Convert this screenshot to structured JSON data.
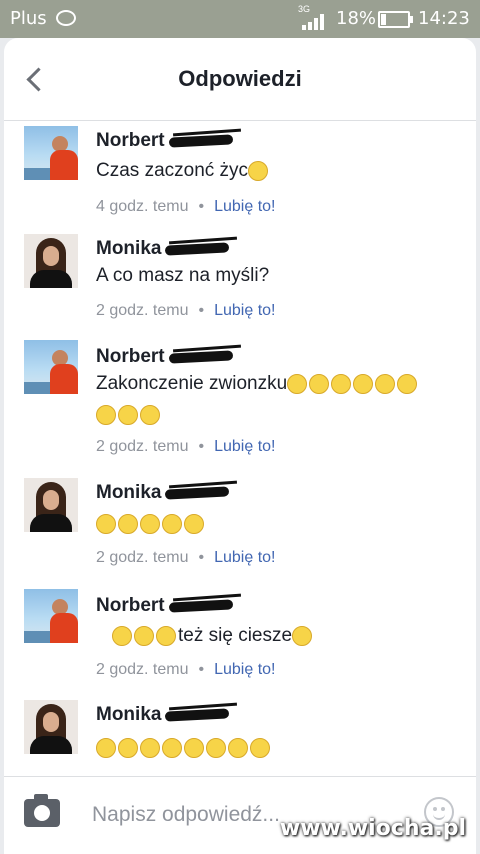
{
  "status_bar": {
    "carrier": "Plus",
    "network": "3G",
    "battery": "18%",
    "battery_level": 0.18,
    "time": "14:23"
  },
  "header": {
    "title": "Odpowiedzi",
    "back_icon": "chevron-left-icon"
  },
  "comments": [
    {
      "author": "Norbert",
      "avatar": "norbert",
      "text": "Czas zaczonć życ",
      "emoji_count": 1,
      "time": "4 godz. temu",
      "like": "Lubię to!"
    },
    {
      "author": "Monika",
      "avatar": "monika",
      "text": "A co masz na myśli?",
      "emoji_count": 0,
      "time": "2 godz. temu",
      "like": "Lubię to!"
    },
    {
      "author": "Norbert",
      "avatar": "norbert",
      "text": "Zakonczenie zwionzku",
      "emoji_count": 9,
      "time": "2 godz. temu",
      "like": "Lubię to!"
    },
    {
      "author": "Monika",
      "avatar": "monika",
      "text": "",
      "emoji_count": 5,
      "time": "2 godz. temu",
      "like": "Lubię to!"
    },
    {
      "author": "Norbert",
      "avatar": "norbert",
      "text": "też się ciesze",
      "emoji_count": 4,
      "time": "2 godz. temu",
      "like": "Lubię to!"
    },
    {
      "author": "Monika",
      "avatar": "monika",
      "text": "",
      "emoji_count": 8,
      "time": "",
      "like": ""
    }
  ],
  "composer": {
    "placeholder": "Napisz odpowiedź...",
    "camera_icon": "camera-icon",
    "emoji_icon": "smiley-icon"
  },
  "watermark": "www.wiocha.pl",
  "colors": {
    "status_bar": "#9aa092",
    "link": "#4267b2",
    "meta": "#90949c",
    "text": "#1d2129"
  }
}
